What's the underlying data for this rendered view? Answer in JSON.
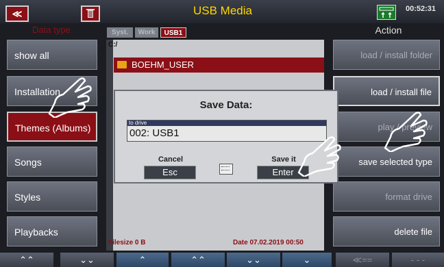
{
  "topbar": {
    "back_symbol": "≪",
    "title": "USB Media",
    "battery_label": "≡≡≡\n↑↑",
    "time": "00:52:31"
  },
  "left": {
    "header": "Data type",
    "items": [
      "show all",
      "Installation",
      "Themes (Albums)",
      "Songs",
      "Styles",
      "Playbacks"
    ]
  },
  "right": {
    "header": "Action",
    "items": [
      "load  /  install  folder",
      "load  /  install  file",
      "play  /  preview",
      "save  selected  type",
      "format  drive",
      "delete  file"
    ]
  },
  "tabs": [
    "Syst.",
    "Work",
    "USB1"
  ],
  "panel": {
    "path": "C:/",
    "folder": "BOEHM_USER",
    "filesize": "Filesize  0  B",
    "date": "Date  07.02.2019   00:50"
  },
  "dialog": {
    "title": "Save Data:",
    "field_caption": "to drive",
    "field_value": "002: USB1",
    "cancel_label": "Cancel",
    "cancel_key": "Esc",
    "save_label": "Save it",
    "save_key": "Enter"
  },
  "bottom": [
    "⌃⌃",
    "⌄⌄",
    "⌃",
    "⌃⌃",
    "⌄⌄",
    "⌄",
    "≪==",
    "- - -"
  ],
  "colors": {
    "accent_red": "#8b0f16",
    "title_yellow": "#ffd700"
  }
}
